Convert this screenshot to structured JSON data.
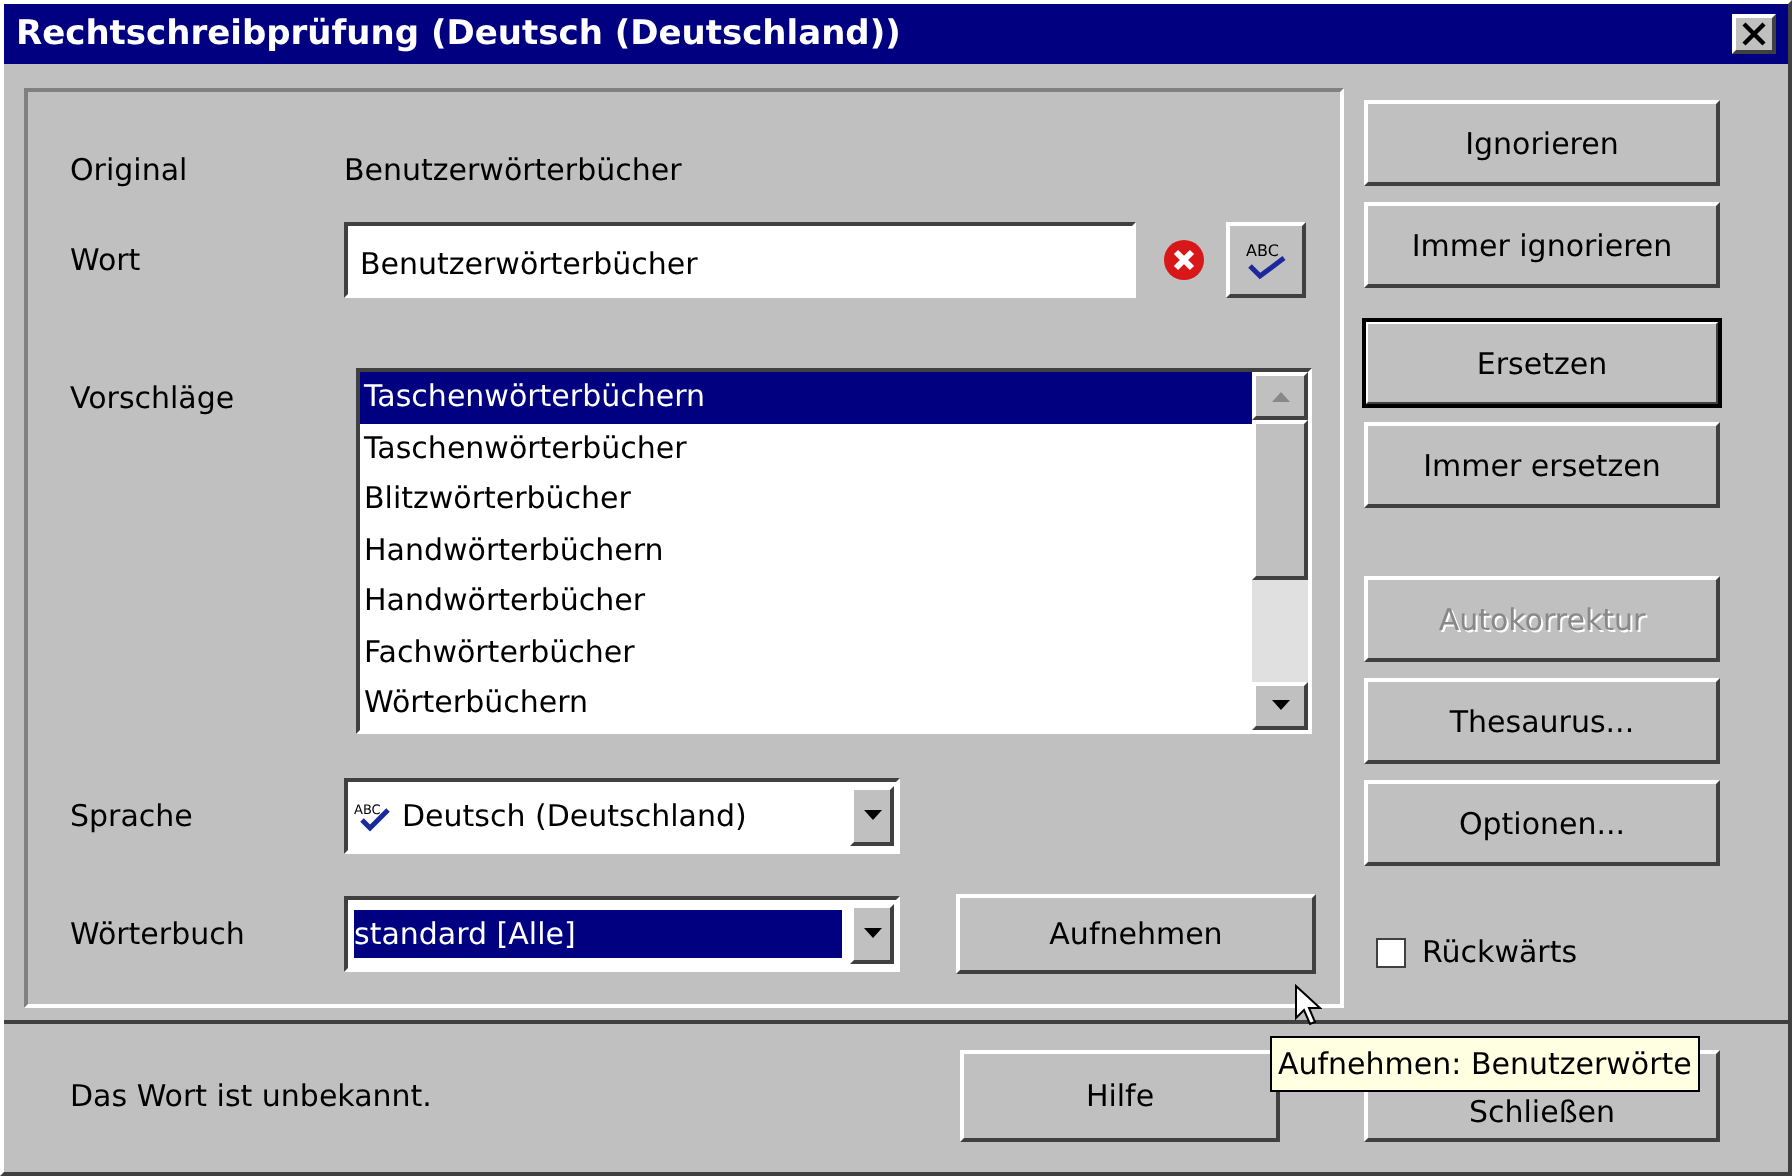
{
  "window": {
    "title": "Rechtschreibprüfung (Deutsch (Deutschland))"
  },
  "original": {
    "label": "Original",
    "value": "Benutzerwörterbücher"
  },
  "word": {
    "label": "Wort",
    "value": "Benutzerwörterbücher",
    "icon_text": "ABC"
  },
  "suggestions": {
    "label": "Vorschläge",
    "items": [
      {
        "text": "Taschenwörterbüchern",
        "selected": true
      },
      {
        "text": "Taschenwörterbücher",
        "selected": false
      },
      {
        "text": "Blitzwörterbücher",
        "selected": false
      },
      {
        "text": "Handwörterbüchern",
        "selected": false
      },
      {
        "text": "Handwörterbücher",
        "selected": false
      },
      {
        "text": "Fachwörterbücher",
        "selected": false
      },
      {
        "text": "Wörterbüchern",
        "selected": false
      }
    ]
  },
  "language": {
    "label": "Sprache",
    "value": "Deutsch (Deutschland)",
    "icon_text": "ABC"
  },
  "dictionary": {
    "label": "Wörterbuch",
    "value": "standard [Alle]"
  },
  "add_button": "Aufnehmen",
  "side_buttons": [
    {
      "label": "Ignorieren",
      "default": false,
      "disabled": false
    },
    {
      "label": "Immer ignorieren",
      "default": false,
      "disabled": false
    },
    {
      "label": "Ersetzen",
      "default": true,
      "disabled": false
    },
    {
      "label": "Immer ersetzen",
      "default": false,
      "disabled": false
    },
    {
      "label": "Autokorrektur",
      "default": false,
      "disabled": true
    },
    {
      "label": "Thesaurus...",
      "default": false,
      "disabled": false
    },
    {
      "label": "Optionen...",
      "default": false,
      "disabled": false
    }
  ],
  "backwards": {
    "label": "Rückwärts",
    "checked": false
  },
  "status": "Das Wort ist unbekannt.",
  "bottom_buttons": [
    "Hilfe",
    "Schließen"
  ],
  "tooltip": "Aufnehmen: Benutzerwörte"
}
